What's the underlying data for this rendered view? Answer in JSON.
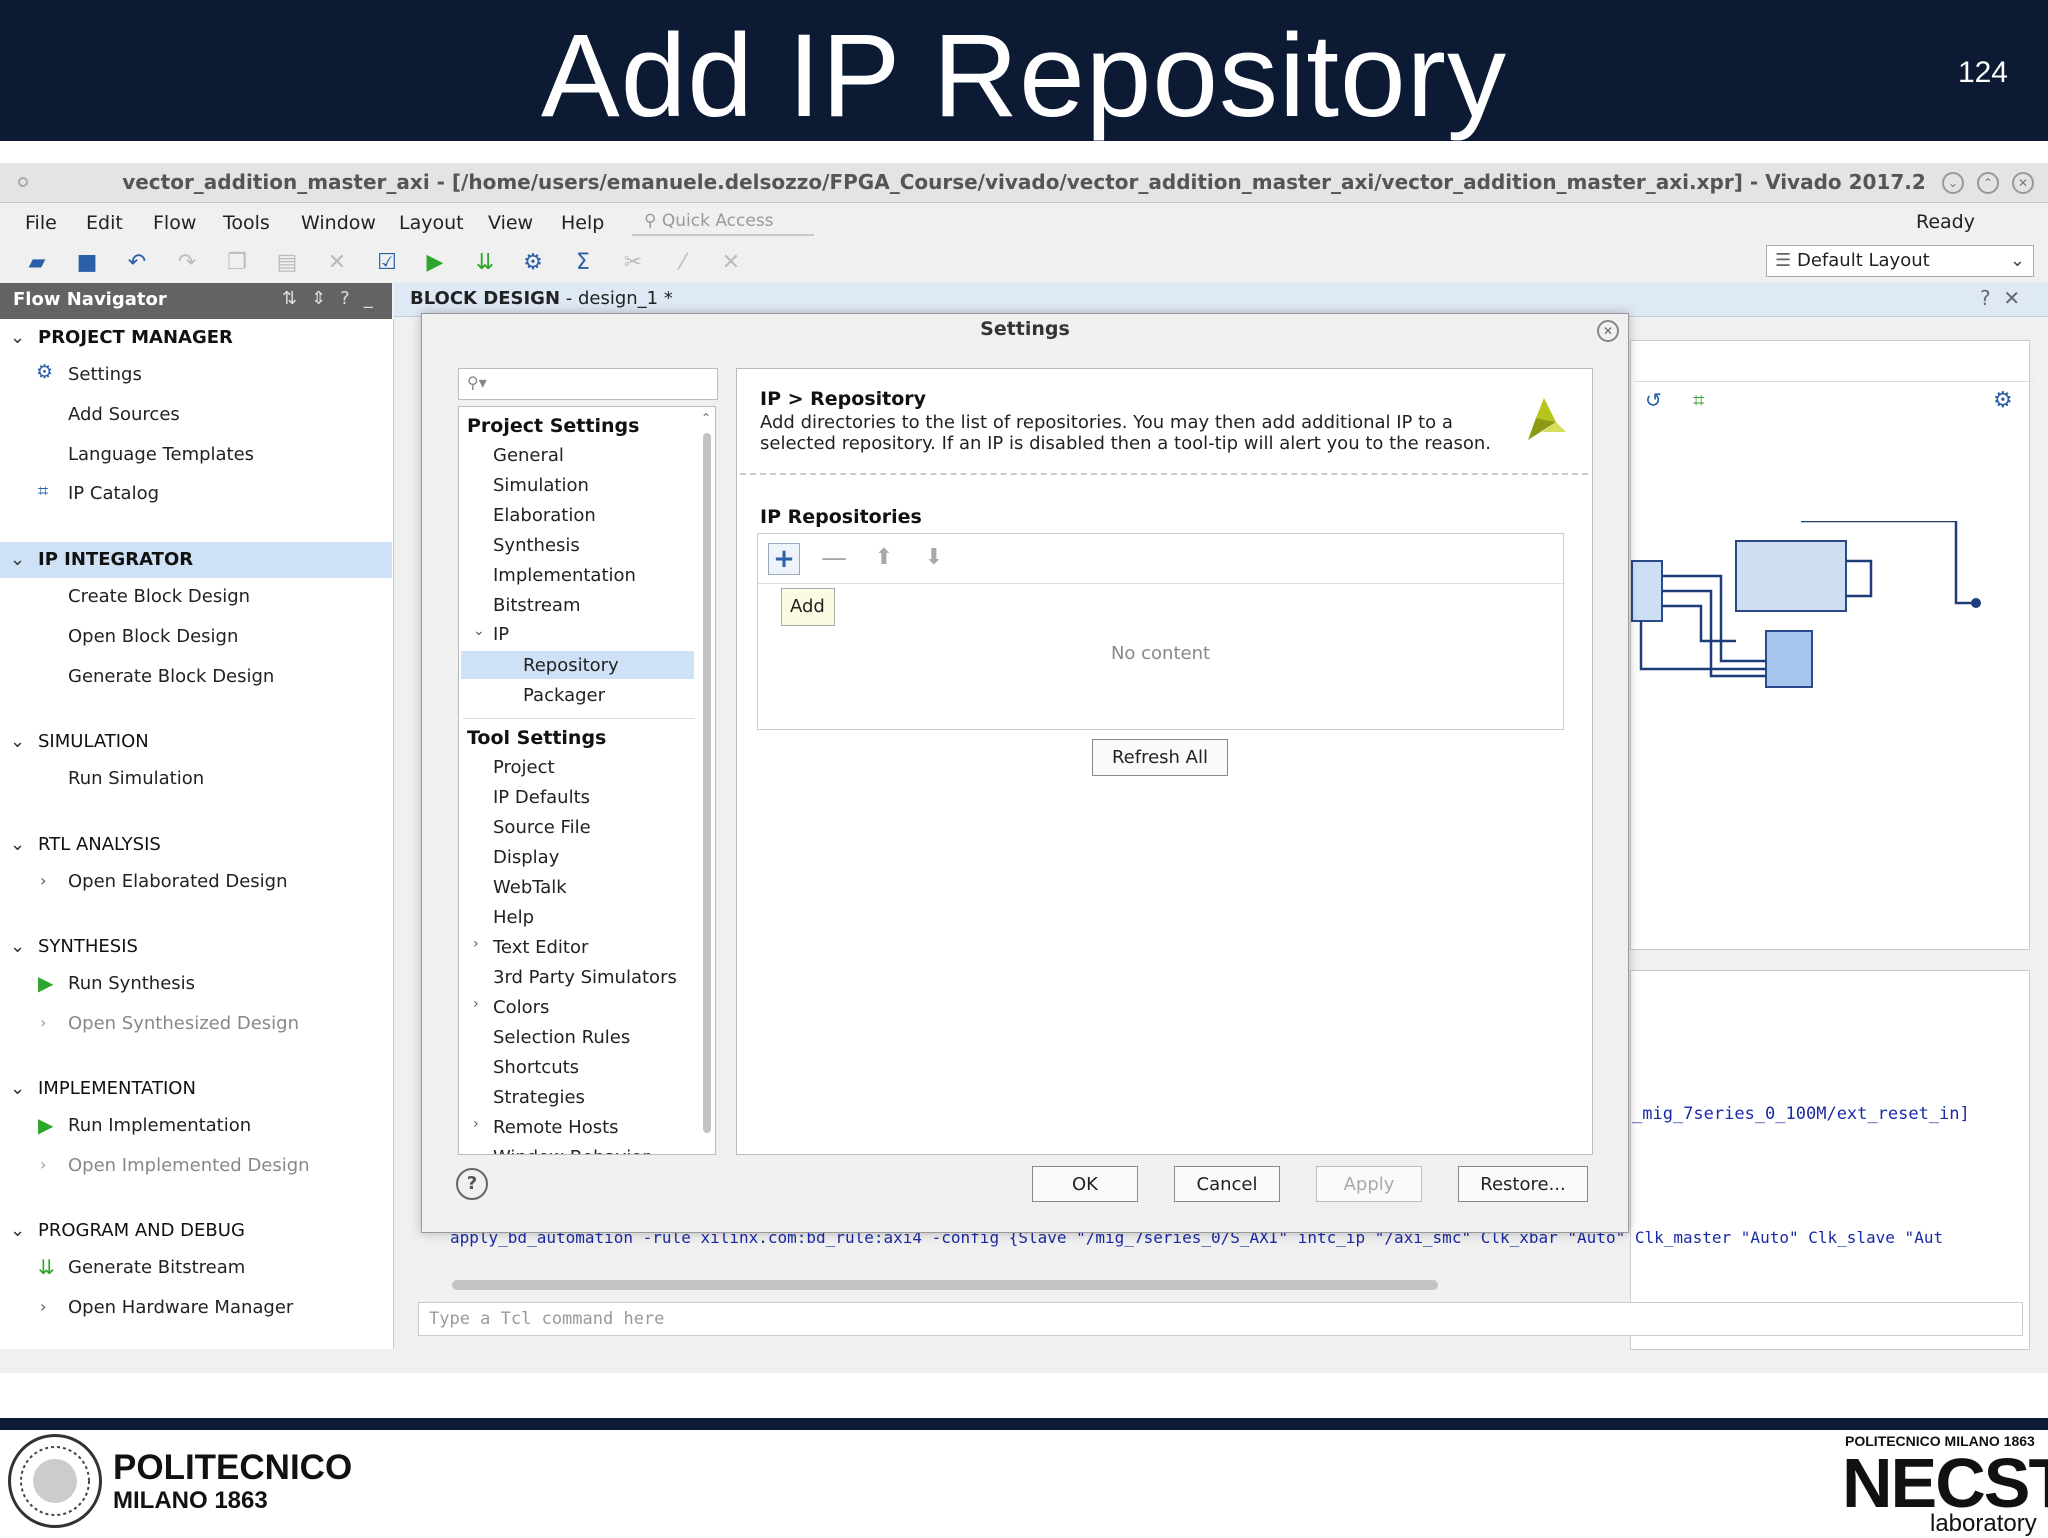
{
  "slide": {
    "title": "Add IP Repository",
    "page_number": "124"
  },
  "window": {
    "title": "vector_addition_master_axi - [/home/users/emanuele.delsozzo/FPGA_Course/vivado/vector_addition_master_axi/vector_addition_master_axi.xpr] - Vivado 2017.2"
  },
  "menu": {
    "items": [
      "File",
      "Edit",
      "Flow",
      "Tools",
      "Window",
      "Layout",
      "View",
      "Help"
    ],
    "quick_access_placeholder": "Quick Access",
    "status": "Ready"
  },
  "toolbar": {
    "layout_select": "Default Layout"
  },
  "flow_navigator": {
    "title": "Flow Navigator",
    "project_manager": {
      "label": "PROJECT MANAGER",
      "items": [
        "Settings",
        "Add Sources",
        "Language Templates",
        "IP Catalog"
      ]
    },
    "ip_integrator": {
      "label": "IP INTEGRATOR",
      "items": [
        "Create Block Design",
        "Open Block Design",
        "Generate Block Design"
      ]
    },
    "simulation": {
      "label": "SIMULATION",
      "items": [
        "Run Simulation"
      ]
    },
    "rtl_analysis": {
      "label": "RTL ANALYSIS",
      "items": [
        "Open Elaborated Design"
      ]
    },
    "synthesis": {
      "label": "SYNTHESIS",
      "items": [
        "Run Synthesis",
        "Open Synthesized Design"
      ]
    },
    "implementation": {
      "label": "IMPLEMENTATION",
      "items": [
        "Run Implementation",
        "Open Implemented Design"
      ]
    },
    "program_debug": {
      "label": "PROGRAM AND DEBUG",
      "items": [
        "Generate Bitstream",
        "Open Hardware Manager"
      ]
    }
  },
  "block_design": {
    "label": "BLOCK DESIGN",
    "name": "- design_1 *"
  },
  "console": {
    "output_line": "_mig_7series_0_100M/ext_reset_in]",
    "tcl_line": "apply_bd_automation -rule xilinx.com:bd_rule:axi4 -config {Slave \"/mig_7series_0/S_AXI\" intc_ip \"/axi_smc\" Clk_xbar \"Auto\" Clk_master \"Auto\" Clk_slave \"Aut",
    "tcl_placeholder": "Type a Tcl command here"
  },
  "dialog": {
    "title": "Settings",
    "project_settings": {
      "label": "Project Settings",
      "items": [
        "General",
        "Simulation",
        "Elaboration",
        "Synthesis",
        "Implementation",
        "Bitstream",
        "IP",
        "Repository",
        "Packager"
      ]
    },
    "tool_settings": {
      "label": "Tool Settings",
      "items": [
        "Project",
        "IP Defaults",
        "Source File",
        "Display",
        "WebTalk",
        "Help",
        "Text Editor",
        "3rd Party Simulators",
        "Colors",
        "Selection Rules",
        "Shortcuts",
        "Strategies",
        "Remote Hosts",
        "Window Behavior"
      ]
    },
    "panel": {
      "title": "IP > Repository",
      "description": "Add directories to the list of repositories. You may then add additional IP to a selected repository. If an IP is disabled then a tool-tip will alert you to the reason.",
      "repos_label": "IP Repositories",
      "add_tooltip": "Add",
      "empty_text": "No content",
      "refresh_label": "Refresh All"
    },
    "buttons": {
      "ok": "OK",
      "cancel": "Cancel",
      "apply": "Apply",
      "restore": "Restore..."
    }
  },
  "footer": {
    "polimi_name": "POLITECNICO",
    "polimi_sub": "MILANO 1863",
    "necst_top": "POLITECNICO MILANO 1863",
    "necst_word": "NECST",
    "necst_lab": "laboratory"
  },
  "colors": {
    "banner": "#0d1a33",
    "accent_blue": "#1a4e8a",
    "selection": "#cfe1f6"
  }
}
